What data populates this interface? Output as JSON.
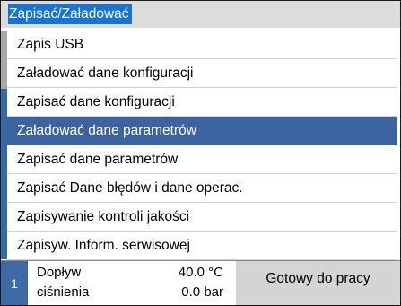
{
  "window": {
    "title": "Zapisać/Załadować"
  },
  "menu": {
    "items": [
      {
        "label": "Zapis USB",
        "selected": false
      },
      {
        "label": "Załadować dane konfiguracji",
        "selected": false
      },
      {
        "label": "Zapisać dane konfiguracji",
        "selected": false
      },
      {
        "label": "Załadować dane parametrów",
        "selected": true
      },
      {
        "label": "Zapisać dane parametrów",
        "selected": false
      },
      {
        "label": "Zapisać Dane błędów i dane operac.",
        "selected": false
      },
      {
        "label": "Zapisywanie kontroli jakości",
        "selected": false
      },
      {
        "label": "Zapisyw. Inform. serwisowej",
        "selected": false
      }
    ]
  },
  "status": {
    "number": "1",
    "rows": [
      {
        "label": "Dopływ",
        "value": "40.0 °C"
      },
      {
        "label": "ciśnienia",
        "value": "0.0 bar"
      }
    ],
    "message": "Gotowy do pracy"
  },
  "colors": {
    "title_highlight": "#1673d9",
    "selected_row": "#3a63a0",
    "status_number_bg": "#3e6aa5",
    "title_bar_bg": "#dcdcdc",
    "status_bg": "#d4d4d4"
  }
}
